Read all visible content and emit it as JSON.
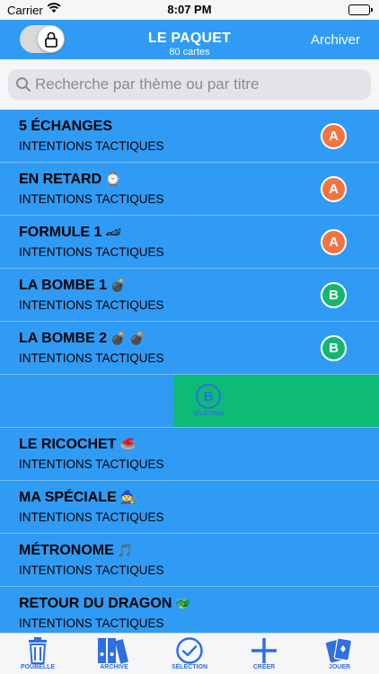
{
  "status_bar": {
    "carrier": "Carrier",
    "time": "8:07 PM"
  },
  "nav": {
    "title": "LE PAQUET",
    "subtitle": "80 cartes",
    "archive_label": "Archiver",
    "lock_toggle": {
      "icon": "lock-icon",
      "on": true
    }
  },
  "search": {
    "placeholder": "Recherche par thème ou par titre",
    "value": ""
  },
  "colors": {
    "accent": "#2f9bf5",
    "badge_a": "#f37343",
    "badge_b": "#13b870",
    "swipe_green": "#0dbb76",
    "tab_blue": "#2f6fe0"
  },
  "rows": [
    {
      "title": "5 ÉCHANGES",
      "emoji": "",
      "subtitle": "INTENTIONS TACTIQUES",
      "badge": "A"
    },
    {
      "title": "EN RETARD",
      "emoji": "⌚",
      "subtitle": "INTENTIONS TACTIQUES",
      "badge": "A"
    },
    {
      "title": "FORMULE 1",
      "emoji": "🏎",
      "subtitle": "INTENTIONS TACTIQUES",
      "badge": "A"
    },
    {
      "title": "LA BOMBE 1",
      "emoji": "💣",
      "subtitle": "INTENTIONS TACTIQUES",
      "badge": "B"
    },
    {
      "title": "LA BOMBE 2",
      "emoji": "💣 💣",
      "subtitle": "INTENTIONS TACTIQUES",
      "badge": "B"
    }
  ],
  "swipe_action": {
    "letter": "B",
    "label": "SÉLECTION"
  },
  "rows_after": [
    {
      "title": "LE RICOCHET",
      "emoji": "🥌",
      "subtitle": "INTENTIONS TACTIQUES"
    },
    {
      "title": "MA SPÉCIALE",
      "emoji": "🧙",
      "subtitle": "INTENTIONS TACTIQUES"
    },
    {
      "title": "MÉTRONOME",
      "emoji": "🎵",
      "subtitle": "INTENTIONS TACTIQUES"
    },
    {
      "title": "RETOUR DU DRAGON",
      "emoji": "🐲",
      "subtitle": "INTENTIONS TACTIQUES"
    }
  ],
  "tabs": [
    {
      "label": "POUBELLE",
      "icon": "trash-icon"
    },
    {
      "label": "ARCHIVE",
      "icon": "archive-binders-icon"
    },
    {
      "label": "SÉLECTION",
      "icon": "checkmark-circle-icon"
    },
    {
      "label": "CRÉER",
      "icon": "plus-icon"
    },
    {
      "label": "JOUER",
      "icon": "playing-cards-icon"
    }
  ]
}
